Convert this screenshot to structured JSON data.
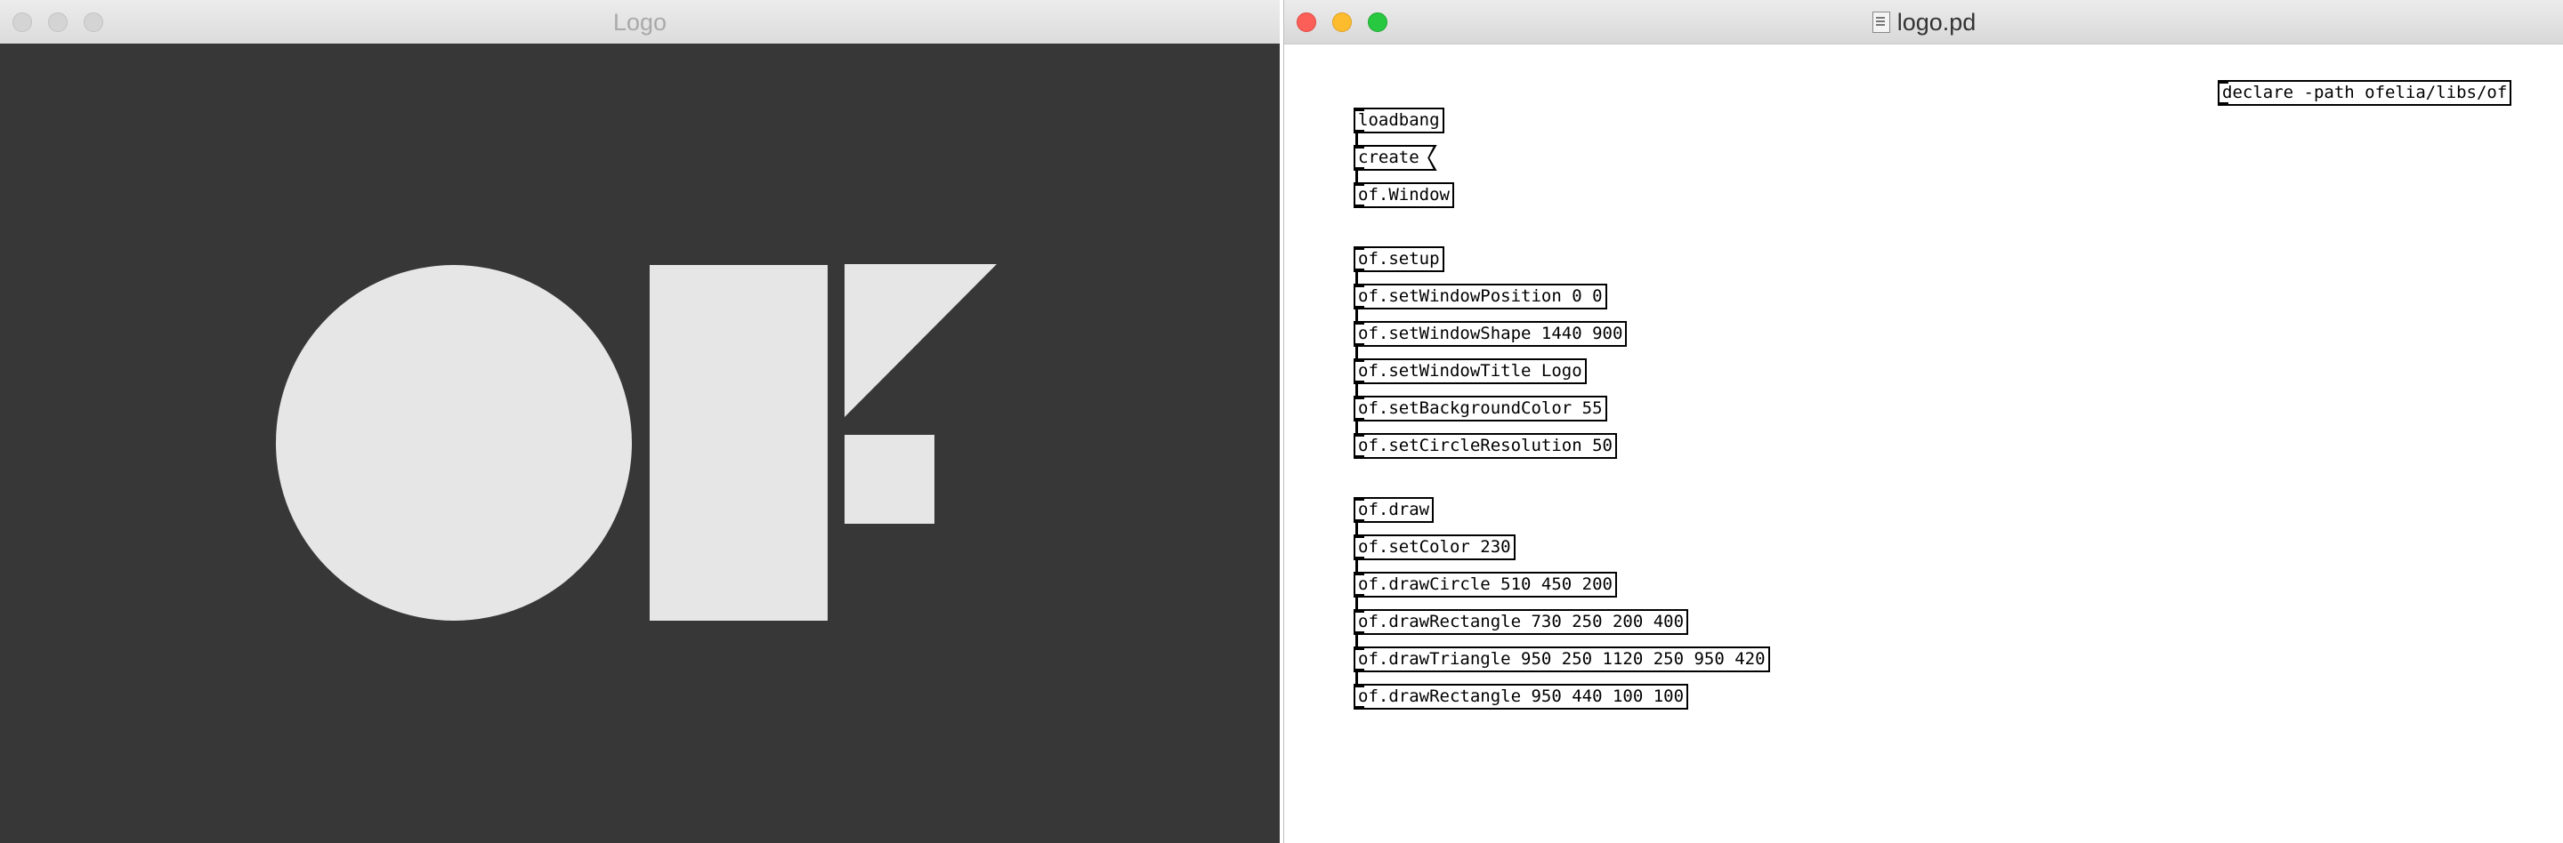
{
  "logo_window": {
    "title": "Logo",
    "background_color": "#373737",
    "shape_color": "#e6e6e6",
    "traffic_lights": [
      "close-button",
      "minimize-button",
      "zoom-button"
    ]
  },
  "patch_window": {
    "title": "logo.pd",
    "icon": "pd-document-icon",
    "declare": "declare -path ofelia/libs/of",
    "objects": {
      "loadbang": "loadbang",
      "create": "create",
      "window": "of.Window",
      "setup": "of.setup",
      "set_window_position": "of.setWindowPosition 0 0",
      "set_window_shape": "of.setWindowShape 1440 900",
      "set_window_title": "of.setWindowTitle Logo",
      "set_background_color": "of.setBackgroundColor 55",
      "set_circle_resolution": "of.setCircleResolution 50",
      "draw": "of.draw",
      "set_color": "of.setColor 230",
      "draw_circle": "of.drawCircle 510 450 200",
      "draw_rectangle_1": "of.drawRectangle 730 250 200 400",
      "draw_triangle": "of.drawTriangle 950 250 1120 250 950 420",
      "draw_rectangle_2": "of.drawRectangle 950 440 100 100"
    }
  }
}
